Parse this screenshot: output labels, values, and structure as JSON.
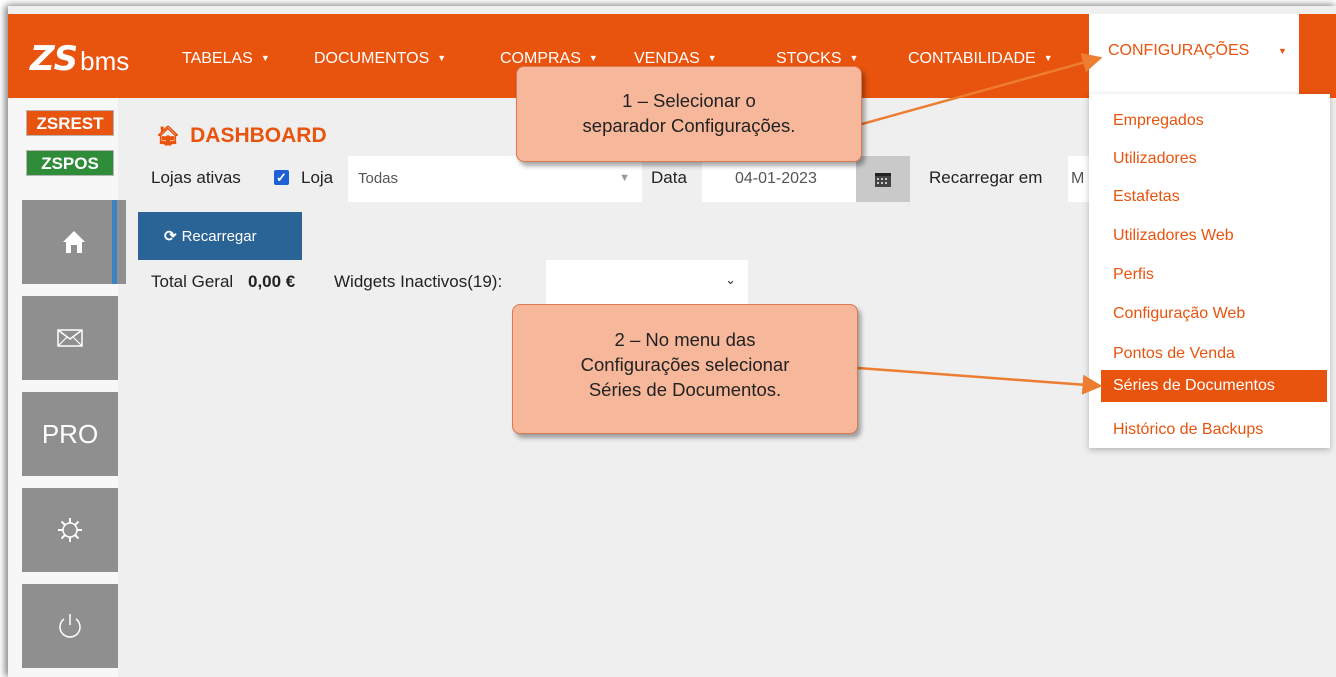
{
  "brand": {
    "zs": "ZS",
    "bms": "bms"
  },
  "nav": {
    "items": [
      {
        "label": "TABELAS"
      },
      {
        "label": "DOCUMENTOS"
      },
      {
        "label": "COMPRAS"
      },
      {
        "label": "VENDAS"
      },
      {
        "label": "STOCKS"
      },
      {
        "label": "CONTABILIDADE"
      }
    ],
    "active": {
      "label": "CONFIGURAÇÕES"
    },
    "caret": "▼"
  },
  "sidebar": {
    "tags": [
      "ZSREST",
      "ZSPOS"
    ],
    "pro_label": "PRO",
    "icons": [
      "home-icon",
      "mail-icon",
      "gear-icon",
      "power-icon"
    ],
    "active_accent_color": "#3b82c4"
  },
  "dashboard": {
    "title": "DASHBOARD",
    "lojas_ativas_label": "Lojas ativas",
    "lojas_ativas_checked": true,
    "loja_label": "Loja",
    "loja_value": "Todas",
    "data_label": "Data",
    "data_value": "04-01-2023",
    "recarregar_em_label": "Recarregar em",
    "recarregar_em_value": "M",
    "reload_button": "Recarregar",
    "total_geral_label": "Total Geral",
    "total_geral_value": "0,00 €",
    "widgets_label": "Widgets Inactivos(19):"
  },
  "dropdown": {
    "items": [
      "Empregados",
      "Utilizadores",
      "Estafetas",
      "Utilizadores Web",
      "Perfis",
      "Configuração Web",
      "Pontos de Venda",
      "Séries de Documentos",
      "Histórico de Backups"
    ],
    "active_index": 7
  },
  "callouts": {
    "step1": [
      "1 – Selecionar o",
      "separador Configurações."
    ],
    "step2": [
      "2 – No menu das",
      "Configurações selecionar",
      "Séries de Documentos."
    ]
  },
  "colors": {
    "brand_orange": "#e8530e",
    "zspos_green": "#2f8d3a",
    "reload_blue": "#2a6496",
    "callout_fill": "#f7b79a",
    "arrow_orange": "#ed7d31"
  }
}
